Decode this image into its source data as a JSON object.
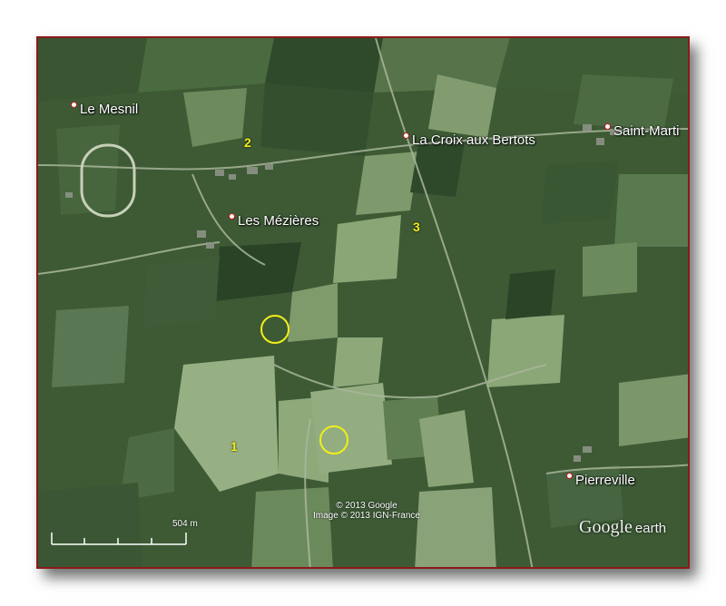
{
  "map": {
    "places": [
      {
        "name": "Le Mesnil"
      },
      {
        "name": "La Croix aux Bertots"
      },
      {
        "name": "Saint-Marti"
      },
      {
        "name": "Les Mézières"
      },
      {
        "name": "Pierreville"
      }
    ],
    "markers": [
      {
        "label": "1"
      },
      {
        "label": "2"
      },
      {
        "label": "3"
      }
    ],
    "circle_markers": 2,
    "marker_color": "#f2ee1a",
    "pin_color": "#c2181f",
    "attribution": {
      "line1": "© 2013 Google",
      "line2": "Image © 2013 IGN-France"
    },
    "scale": {
      "label": "504 m"
    },
    "logo": {
      "brand": "Google",
      "product": "earth"
    }
  }
}
